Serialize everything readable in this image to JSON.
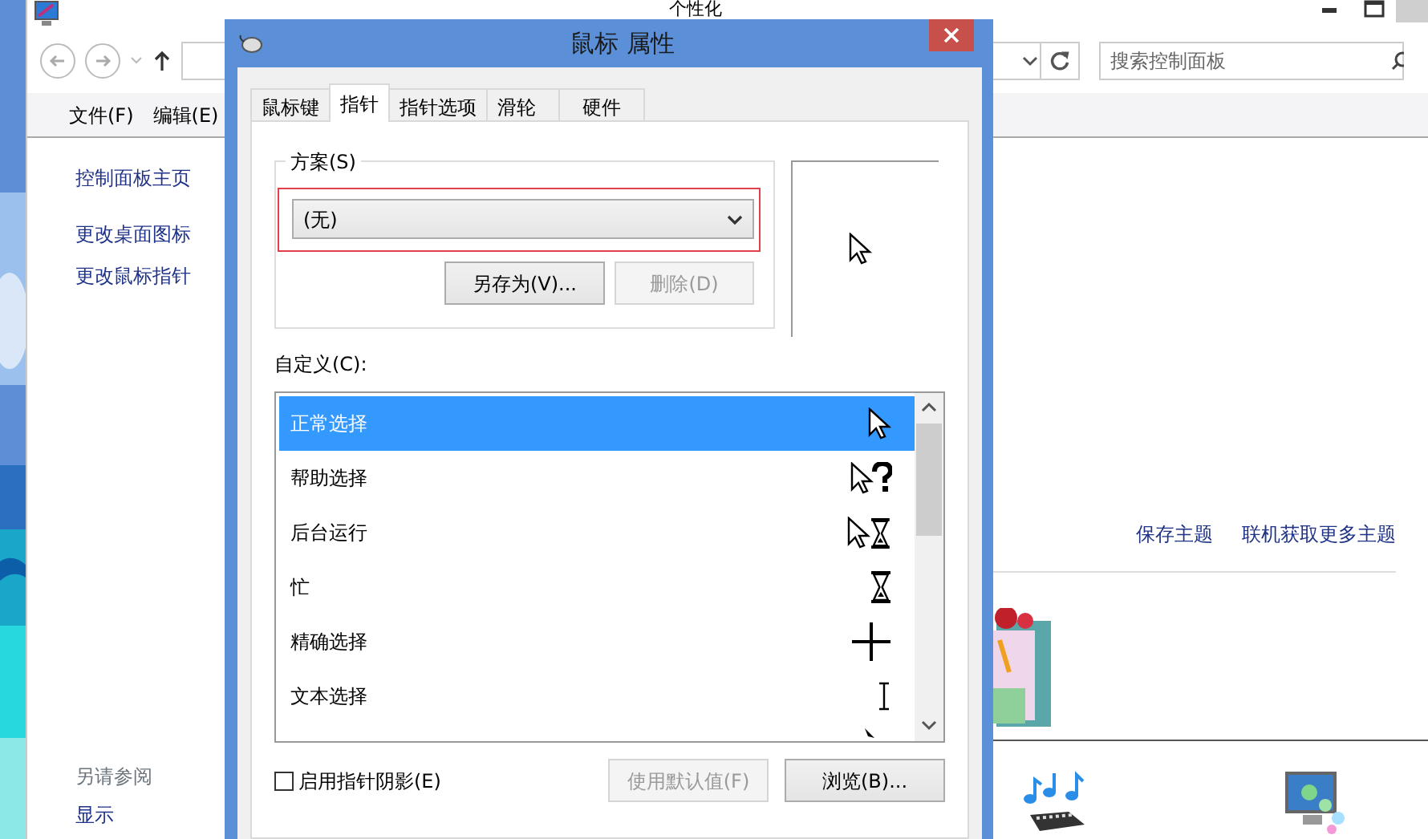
{
  "background_window": {
    "title": "个性化",
    "search": {
      "placeholder": "搜索控制面板"
    },
    "menu": [
      "文件(F)",
      "编辑(E)"
    ],
    "sidebar": {
      "items": [
        "控制面板主页",
        "更改桌面图标",
        "更改鼠标指针"
      ],
      "see_also_title": "另请参阅",
      "see_also": [
        "显示"
      ]
    },
    "links": [
      "保存主题",
      "联机获取更多主题"
    ]
  },
  "dialog": {
    "title": "鼠标 属性",
    "tabs": [
      {
        "label": "鼠标键",
        "selected": false
      },
      {
        "label": "指针",
        "selected": true
      },
      {
        "label": "指针选项",
        "selected": false
      },
      {
        "label": "滑轮",
        "selected": false
      },
      {
        "label": "硬件",
        "selected": false
      }
    ],
    "scheme": {
      "label": "方案(S)",
      "value": "(无)",
      "buttons": [
        {
          "label": "另存为(V)...",
          "disabled": false
        },
        {
          "label": "删除(D)",
          "disabled": true
        }
      ]
    },
    "customize": {
      "label": "自定义(C):",
      "items": [
        {
          "label": "正常选择",
          "kind": "arrow",
          "selected": true
        },
        {
          "label": "帮助选择",
          "kind": "help",
          "selected": false
        },
        {
          "label": "后台运行",
          "kind": "working",
          "selected": false
        },
        {
          "label": "忙",
          "kind": "busy",
          "selected": false
        },
        {
          "label": "精确选择",
          "kind": "cross",
          "selected": false
        },
        {
          "label": "文本选择",
          "kind": "text",
          "selected": false
        },
        {
          "kind": "partial",
          "selected": false
        }
      ]
    },
    "shadow": {
      "label": "启用指针阴影(E)",
      "checked": false
    },
    "buttons": [
      {
        "label": "使用默认值(F)",
        "disabled": true
      },
      {
        "label": "浏览(B)...",
        "disabled": false
      }
    ]
  }
}
